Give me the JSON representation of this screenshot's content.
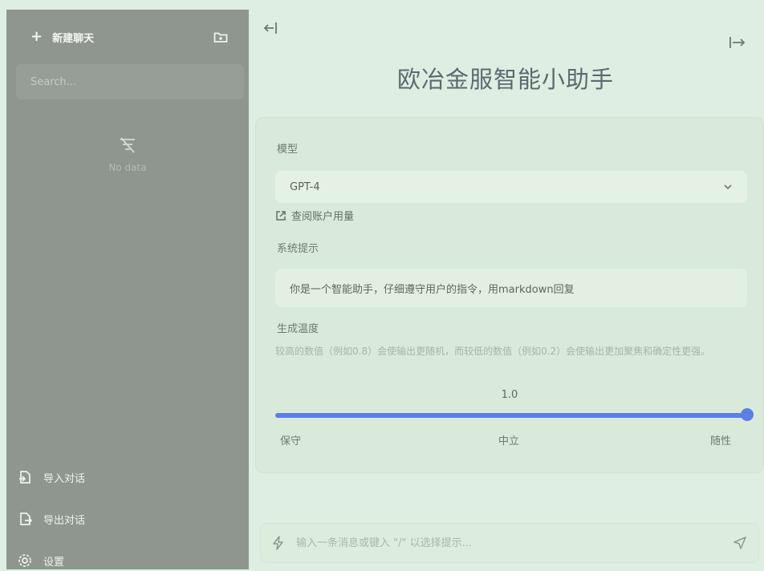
{
  "sidebar": {
    "new_chat_label": "新建聊天",
    "search_placeholder": "Search...",
    "empty_text": "No data",
    "import_label": "导入对话",
    "export_label": "导出对话",
    "settings_label": "设置"
  },
  "main": {
    "title": "欧冶金服智能小助手",
    "model_label": "模型",
    "model_value": "GPT-4",
    "usage_link": "查阅账户用量",
    "system_prompt_label": "系统提示",
    "system_prompt_value": "你是一个智能助手，仔细遵守用户的指令，用markdown回复",
    "temperature_label": "生成温度",
    "temperature_help": "较高的数值（例如0.8）会使输出更随机，而较低的数值（例如0.2）会使输出更加聚焦和确定性更强。",
    "temperature_value": "1.0",
    "temperature_fraction": 1.0,
    "tick_left": "保守",
    "tick_mid": "中立",
    "tick_right": "随性",
    "input_placeholder": "输入一条消息或键入 \"/\" 以选择提示..."
  },
  "colors": {
    "sidebar_bg": "#8f968f",
    "main_bg": "#dfeee2",
    "accent": "#5a7fe6"
  },
  "icons": [
    "plus-icon",
    "folder-plus-icon",
    "no-data-icon",
    "import-icon",
    "export-icon",
    "settings-icon",
    "collapse-left-icon",
    "expand-right-icon",
    "external-link-icon",
    "chevron-down-icon",
    "bolt-icon",
    "send-icon"
  ]
}
